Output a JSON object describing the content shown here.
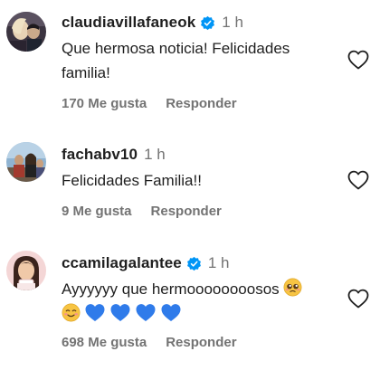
{
  "comments": [
    {
      "username": "claudiavillafaneok",
      "verified": true,
      "time": "1 h",
      "text": "Que hermosa noticia! Felicidades familia!",
      "likes": "170 Me gusta",
      "reply_label": "Responder",
      "avatar_icon": "profile-photo"
    },
    {
      "username": "fachabv10",
      "verified": false,
      "time": "1 h",
      "text": "Felicidades Familia!!",
      "likes": "9 Me gusta",
      "reply_label": "Responder",
      "avatar_icon": "profile-photo"
    },
    {
      "username": "ccamilagalantee",
      "verified": true,
      "time": "1 h",
      "text": "Ayyyyyy que hermoooooooosos",
      "emojis": [
        "pleading-face-emoji",
        "smiling-face-emoji",
        "blue-heart-emoji",
        "blue-heart-emoji",
        "blue-heart-emoji",
        "blue-heart-emoji"
      ],
      "likes": "698 Me gusta",
      "reply_label": "Responder",
      "avatar_icon": "profile-photo"
    }
  ],
  "colors": {
    "username": "#1f1f1f",
    "secondary": "#737373",
    "verified_badge": "#0095f6",
    "blue_heart": "#2f7bea"
  }
}
